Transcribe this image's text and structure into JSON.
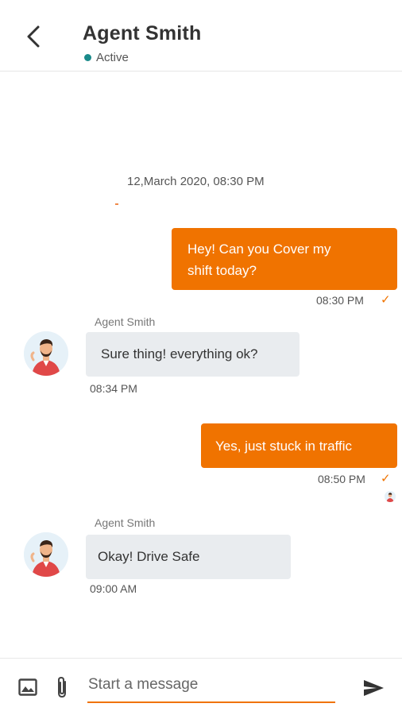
{
  "header": {
    "title": "Agent Smith",
    "status": "Active"
  },
  "chat": {
    "date_separator": "12,March 2020, 08:30 PM",
    "messages": [
      {
        "direction": "outgoing",
        "text_line1": "Hey! Can you Cover my",
        "text_line2": "shift today?",
        "time": "08:30 PM",
        "check": "✓"
      },
      {
        "direction": "incoming",
        "sender": "Agent Smith",
        "text": "Sure thing! everything ok?",
        "time": "08:34 PM"
      },
      {
        "direction": "outgoing",
        "text": "Yes, just stuck in traffic",
        "time": "08:50 PM",
        "check": "✓"
      },
      {
        "direction": "incoming",
        "sender": "Agent Smith",
        "text": "Okay! Drive Safe",
        "time": "09:00 AM"
      }
    ]
  },
  "composer": {
    "placeholder": "Start a message"
  },
  "colors": {
    "accent": "#f07300",
    "incoming_bubble": "#e9ecef",
    "status_dot": "#1a8a8a"
  },
  "icons": {
    "back": "chevron-left-icon",
    "image": "image-icon",
    "attach": "paperclip-icon",
    "send": "send-icon"
  }
}
